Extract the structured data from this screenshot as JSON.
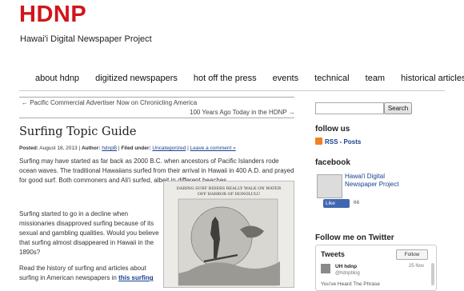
{
  "site": {
    "logo": "HDNP",
    "tagline": "Hawai'i Digital Newspaper Project"
  },
  "nav": {
    "items": [
      "about hdnp",
      "digitized newspapers",
      "hot off the press",
      "events",
      "technical",
      "team",
      "historical articles"
    ]
  },
  "post_nav": {
    "prev": "← Pacific Commercial Advertiser Now on Chronicling America",
    "next": "100 Years Ago Today in the HDNP →"
  },
  "post": {
    "title": "Surfing Topic Guide",
    "meta": {
      "posted_label": "Posted:",
      "date": "August 18, 2013",
      "author_label": "Author:",
      "author": "hdnpB",
      "filed_label": "Filed under:",
      "category": "Uncategorized",
      "comment": "Leave a comment »"
    },
    "para1": "Surfing may have started as far back as 2000 B.C. when ancestors of Pacific Islanders rode ocean waves. The traditional Hawaiians surfed from their arrival in Hawaii in 400 A.D. and prayed for good surf. Both commoners and Ali'i surfed, albeit in different beaches.",
    "para2": "Surfing started to go in a decline when missionaries disapproved surfing because of its sexual and gambling qualities. Would you believe that surfing almost disappeared in Hawaii in the 1890s?",
    "para3_pre": "Read the history of surfing and articles about surfing in American newspapers in ",
    "para3_link": "this surfing",
    "image_caption": "DARING SURF RIDERS REALLY WALK ON WATER OFF HARBOR OF HONOLULU"
  },
  "sidebar": {
    "search_button": "Search",
    "follow_heading": "follow us",
    "rss_label": "RSS - Posts",
    "facebook_heading": "facebook",
    "fb_page_name": "Hawai'i Digital Newspaper Project",
    "fb_like": "Like",
    "fb_count": "66",
    "twitter_heading": "Follow me on Twitter",
    "tweets_title": "Tweets",
    "tweets_follow": "Follow",
    "tweet_user": "UH hdnp",
    "tweet_handle": "@hdnpblog",
    "tweet_date": "25 Nov",
    "tweet_text": "You've Heard The Phrase"
  },
  "colors": {
    "logo": "#d0151c",
    "link": "#1a3f8f",
    "rss": "#f08024",
    "facebook": "#4267b2"
  }
}
